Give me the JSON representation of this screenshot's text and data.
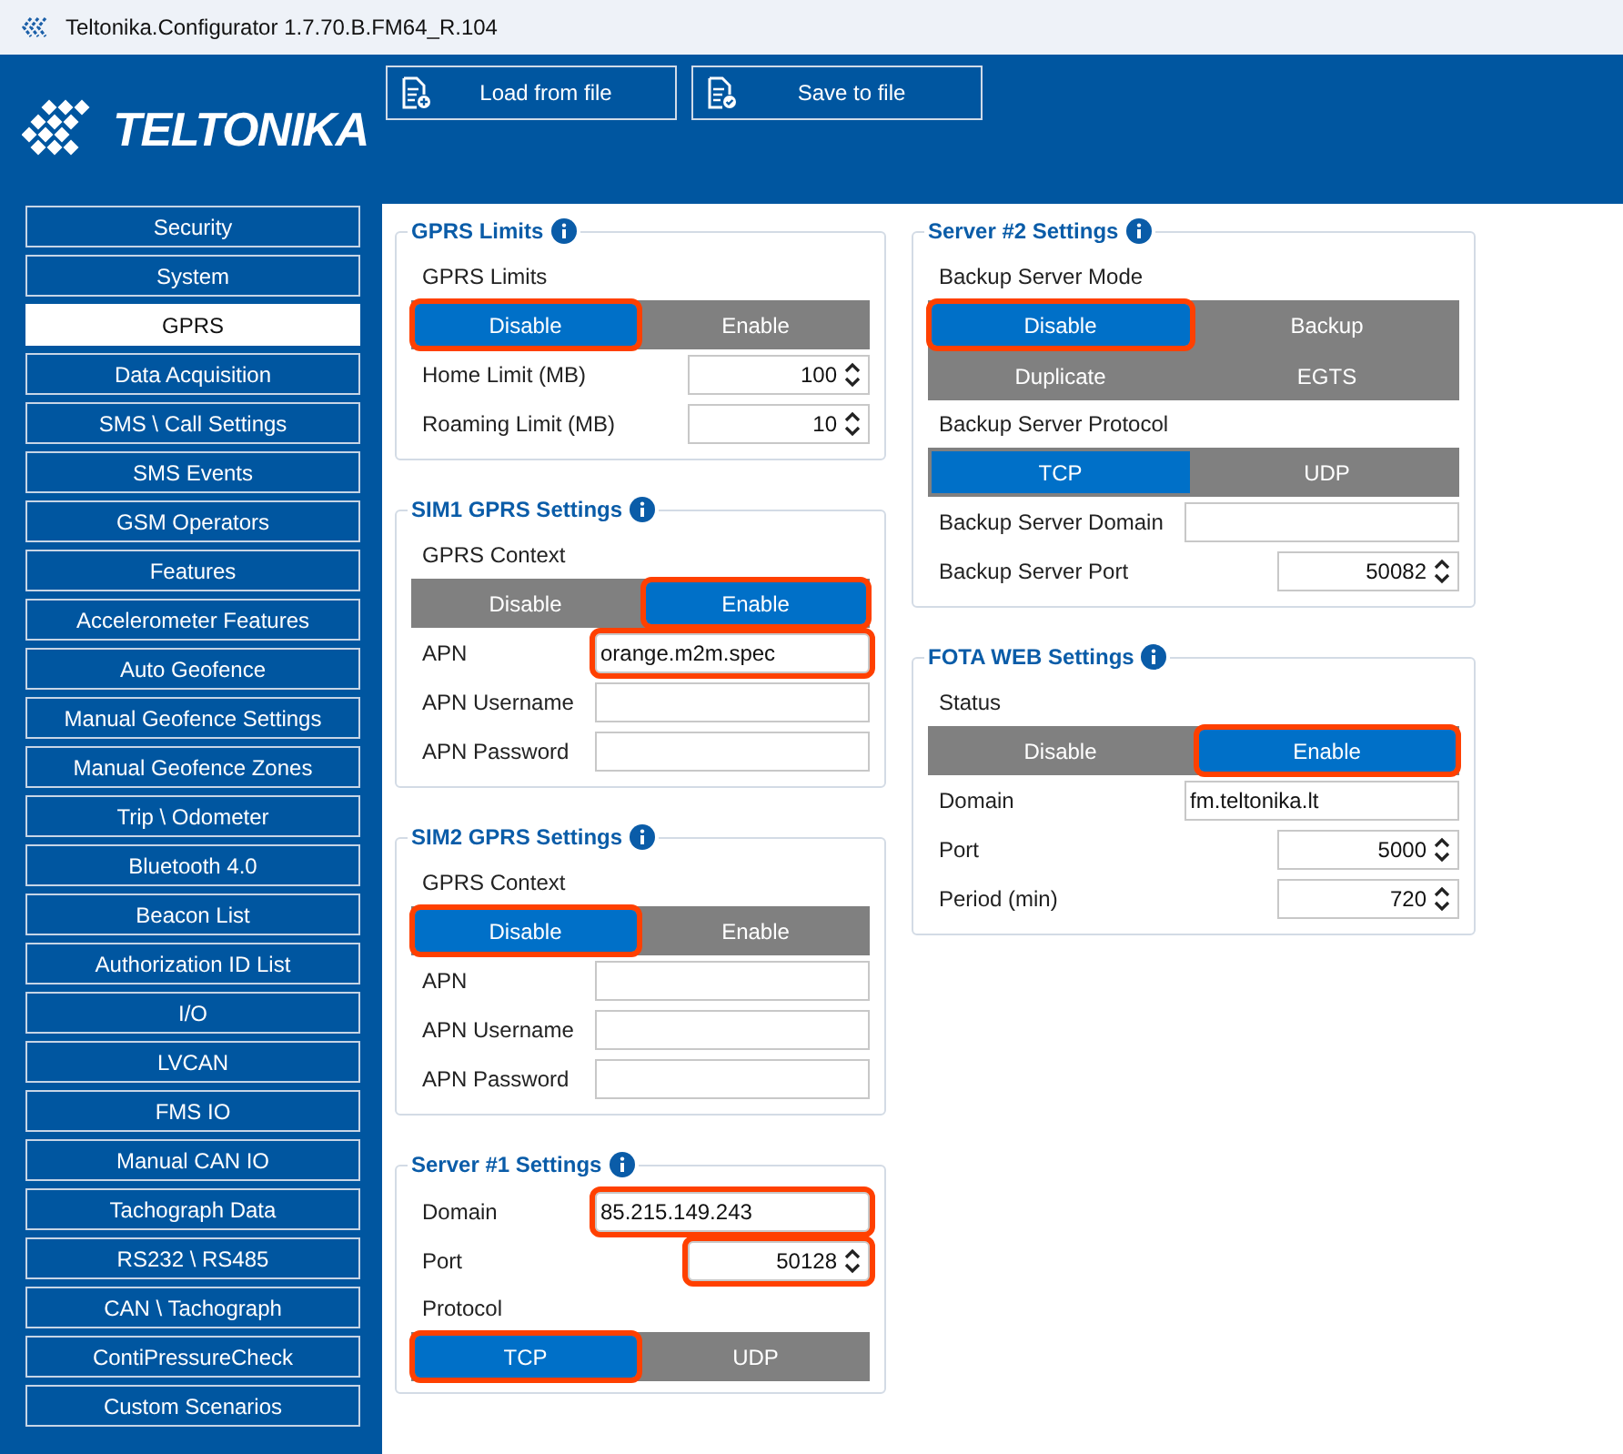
{
  "window": {
    "title": "Teltonika.Configurator 1.7.70.B.FM64_R.104"
  },
  "header": {
    "logo": "TELTONIKA",
    "buttons": [
      {
        "label": "Load from file",
        "kind": "load"
      },
      {
        "label": "Save to file",
        "kind": "save"
      }
    ]
  },
  "sidebar": {
    "items": [
      {
        "label": "Security",
        "selected": false
      },
      {
        "label": "System",
        "selected": false
      },
      {
        "label": "GPRS",
        "selected": true
      },
      {
        "label": "Data Acquisition",
        "selected": false
      },
      {
        "label": "SMS \\ Call Settings",
        "selected": false
      },
      {
        "label": "SMS Events",
        "selected": false
      },
      {
        "label": "GSM Operators",
        "selected": false
      },
      {
        "label": "Features",
        "selected": false
      },
      {
        "label": "Accelerometer Features",
        "selected": false
      },
      {
        "label": "Auto Geofence",
        "selected": false
      },
      {
        "label": "Manual Geofence Settings",
        "selected": false
      },
      {
        "label": "Manual Geofence Zones",
        "selected": false
      },
      {
        "label": "Trip \\ Odometer",
        "selected": false
      },
      {
        "label": "Bluetooth 4.0",
        "selected": false
      },
      {
        "label": "Beacon List",
        "selected": false
      },
      {
        "label": "Authorization ID List",
        "selected": false
      },
      {
        "label": "I/O",
        "selected": false
      },
      {
        "label": "LVCAN",
        "selected": false
      },
      {
        "label": "FMS IO",
        "selected": false
      },
      {
        "label": "Manual CAN IO",
        "selected": false
      },
      {
        "label": "Tachograph Data",
        "selected": false
      },
      {
        "label": "RS232 \\ RS485",
        "selected": false
      },
      {
        "label": "CAN \\ Tachograph",
        "selected": false
      },
      {
        "label": "ContiPressureCheck",
        "selected": false
      },
      {
        "label": "Custom Scenarios",
        "selected": false
      }
    ]
  },
  "columns": [
    {
      "sections": [
        {
          "title": "GPRS Limits",
          "rows": [
            {
              "kind": "label",
              "label": "GPRS Limits"
            },
            {
              "kind": "toggle",
              "options": [
                {
                  "label": "Disable",
                  "selected": true,
                  "highlighted": true
                },
                {
                  "label": "Enable",
                  "selected": false,
                  "highlighted": false
                }
              ]
            },
            {
              "kind": "number",
              "label": "Home Limit (MB)",
              "value": "100",
              "highlighted": false
            },
            {
              "kind": "number",
              "label": "Roaming Limit (MB)",
              "value": "10",
              "highlighted": false
            }
          ]
        },
        {
          "title": "SIM1 GPRS Settings",
          "rows": [
            {
              "kind": "label",
              "label": "GPRS Context"
            },
            {
              "kind": "toggle",
              "options": [
                {
                  "label": "Disable",
                  "selected": false,
                  "highlighted": false
                },
                {
                  "label": "Enable",
                  "selected": true,
                  "highlighted": true
                }
              ]
            },
            {
              "kind": "text",
              "label": "APN",
              "value": "orange.m2m.spec",
              "highlighted": true
            },
            {
              "kind": "text",
              "label": "APN Username",
              "highlighted": false
            },
            {
              "kind": "text",
              "label": "APN Password",
              "highlighted": false
            }
          ]
        },
        {
          "title": "SIM2 GPRS Settings",
          "rows": [
            {
              "kind": "label",
              "label": "GPRS Context"
            },
            {
              "kind": "toggle",
              "options": [
                {
                  "label": "Disable",
                  "selected": true,
                  "highlighted": true
                },
                {
                  "label": "Enable",
                  "selected": false,
                  "highlighted": false
                }
              ]
            },
            {
              "kind": "text",
              "label": "APN",
              "highlighted": false
            },
            {
              "kind": "text",
              "label": "APN Username",
              "highlighted": false
            },
            {
              "kind": "text",
              "label": "APN Password",
              "highlighted": false
            }
          ]
        },
        {
          "title": "Server #1 Settings",
          "rows": [
            {
              "kind": "text",
              "label": "Domain",
              "value": "85.215.149.243",
              "highlighted": true
            },
            {
              "kind": "number",
              "label": "Port",
              "value": "50128",
              "highlighted": true
            },
            {
              "kind": "label",
              "label": "Protocol"
            },
            {
              "kind": "toggle",
              "options": [
                {
                  "label": "TCP",
                  "selected": true,
                  "highlighted": true
                },
                {
                  "label": "UDP",
                  "selected": false,
                  "highlighted": false
                }
              ]
            }
          ]
        }
      ]
    },
    {
      "sections": [
        {
          "title": "Server #2 Settings",
          "rows": [
            {
              "kind": "label",
              "label": "Backup Server Mode"
            },
            {
              "kind": "toggle",
              "options": [
                {
                  "label": "Disable",
                  "selected": true,
                  "highlighted": true
                },
                {
                  "label": "Backup",
                  "selected": false,
                  "highlighted": false
                },
                {
                  "label": "Duplicate",
                  "selected": false,
                  "highlighted": false
                },
                {
                  "label": "EGTS",
                  "selected": false,
                  "highlighted": false
                }
              ]
            },
            {
              "kind": "label",
              "label": "Backup Server Protocol"
            },
            {
              "kind": "toggle",
              "options": [
                {
                  "label": "TCP",
                  "selected": true,
                  "highlighted": false
                },
                {
                  "label": "UDP",
                  "selected": false,
                  "highlighted": false
                }
              ]
            },
            {
              "kind": "text",
              "label": "Backup Server Domain",
              "highlighted": false
            },
            {
              "kind": "number",
              "label": "Backup Server Port",
              "value": "50082",
              "highlighted": false
            }
          ]
        },
        {
          "title": "FOTA WEB Settings",
          "rows": [
            {
              "kind": "label",
              "label": "Status"
            },
            {
              "kind": "toggle",
              "options": [
                {
                  "label": "Disable",
                  "selected": false,
                  "highlighted": false
                },
                {
                  "label": "Enable",
                  "selected": true,
                  "highlighted": true
                }
              ]
            },
            {
              "kind": "text",
              "label": "Domain",
              "value": "fm.teltonika.lt",
              "highlighted": false
            },
            {
              "kind": "number",
              "label": "Port",
              "value": "5000",
              "highlighted": false
            },
            {
              "kind": "number",
              "label": "Period (min)",
              "value": "720",
              "highlighted": false
            }
          ]
        }
      ]
    }
  ]
}
